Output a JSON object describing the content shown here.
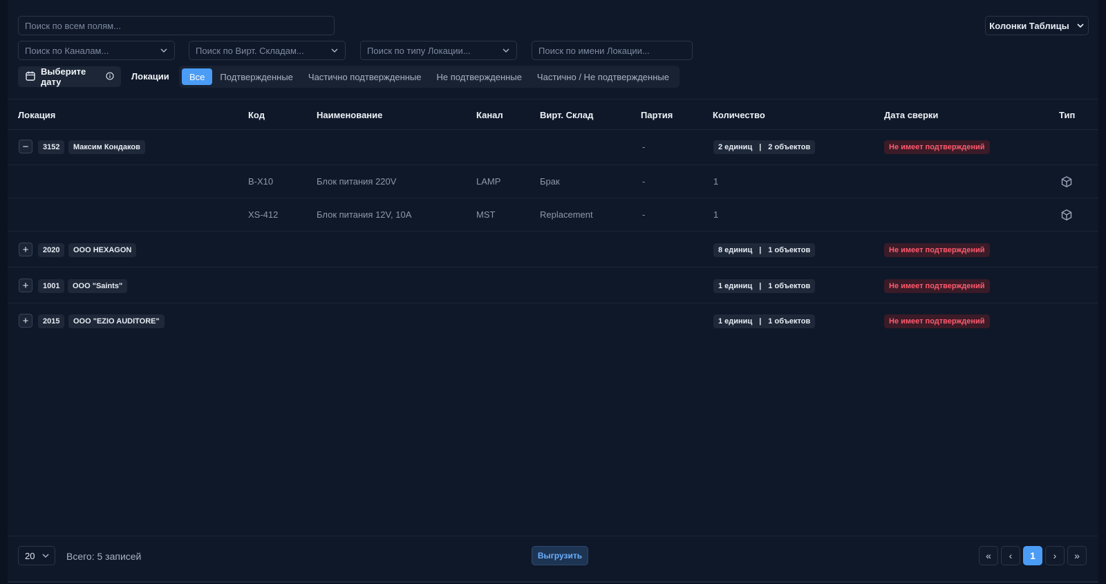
{
  "filters": {
    "search_all_placeholder": "Поиск по всем полям...",
    "channels_placeholder": "Поиск по Каналам...",
    "warehouses_placeholder": "Поиск по Вирт. Складам...",
    "location_type_placeholder": "Поиск по типу Локации...",
    "location_name_placeholder": "Поиск по имени Локации..."
  },
  "columns_button": "Колонки Таблицы",
  "date_button": "Выберите дату",
  "locations_label": "Локации",
  "segments": [
    "Все",
    "Подтвержденные",
    "Частично подтвержденные",
    "Не подтвержденные",
    "Частично / Не подтвержденные"
  ],
  "active_segment": "Все",
  "table": {
    "headers": [
      "Локация",
      "Код",
      "Наименование",
      "Канал",
      "Вирт. Склад",
      "Партия",
      "Количество",
      "Дата сверки",
      "Тип"
    ],
    "groups": [
      {
        "toggle": "−",
        "id": "3152",
        "name": "Максим Кондаков",
        "batch": "-",
        "units": "2 единиц",
        "sep": "|",
        "objects": "2 объектов",
        "status": "Не имеет подтверждений",
        "expanded": true
      },
      {
        "toggle": "+",
        "id": "2020",
        "name": "ООО HEXAGON",
        "units": "8 единиц",
        "sep": "|",
        "objects": "1 объектов",
        "status": "Не имеет подтверждений",
        "expanded": false
      },
      {
        "toggle": "+",
        "id": "1001",
        "name": "ООО \"Saints\"",
        "units": "1 единиц",
        "sep": "|",
        "objects": "1 объектов",
        "status": "Не имеет подтверждений",
        "expanded": false
      },
      {
        "toggle": "+",
        "id": "2015",
        "name": "ООО \"EZIO AUDITORE\"",
        "units": "1 единиц",
        "sep": "|",
        "objects": "1 объектов",
        "status": "Не имеет подтверждений",
        "expanded": false
      }
    ],
    "items": [
      {
        "code": "B-X10",
        "name": "Блок питания 220V",
        "channel": "LAMP",
        "warehouse": "Брак",
        "batch": "-",
        "qty": "1",
        "type_icon": "box-icon"
      },
      {
        "code": "XS-412",
        "name": "Блок питания 12V, 10A",
        "channel": "MST",
        "warehouse": "Replacement",
        "batch": "-",
        "qty": "1",
        "type_icon": "box-icon"
      }
    ]
  },
  "footer": {
    "page_size": "20",
    "total": "Всего: 5 записей",
    "export": "Выгрузить",
    "first": "«",
    "prev": "‹",
    "current_page": "1",
    "next": "›",
    "last": "»"
  },
  "colors": {
    "background": "#0f1829",
    "accent": "#4b9cf5",
    "status_text": "#ff5a6e",
    "status_bg": "#3a1b27"
  }
}
